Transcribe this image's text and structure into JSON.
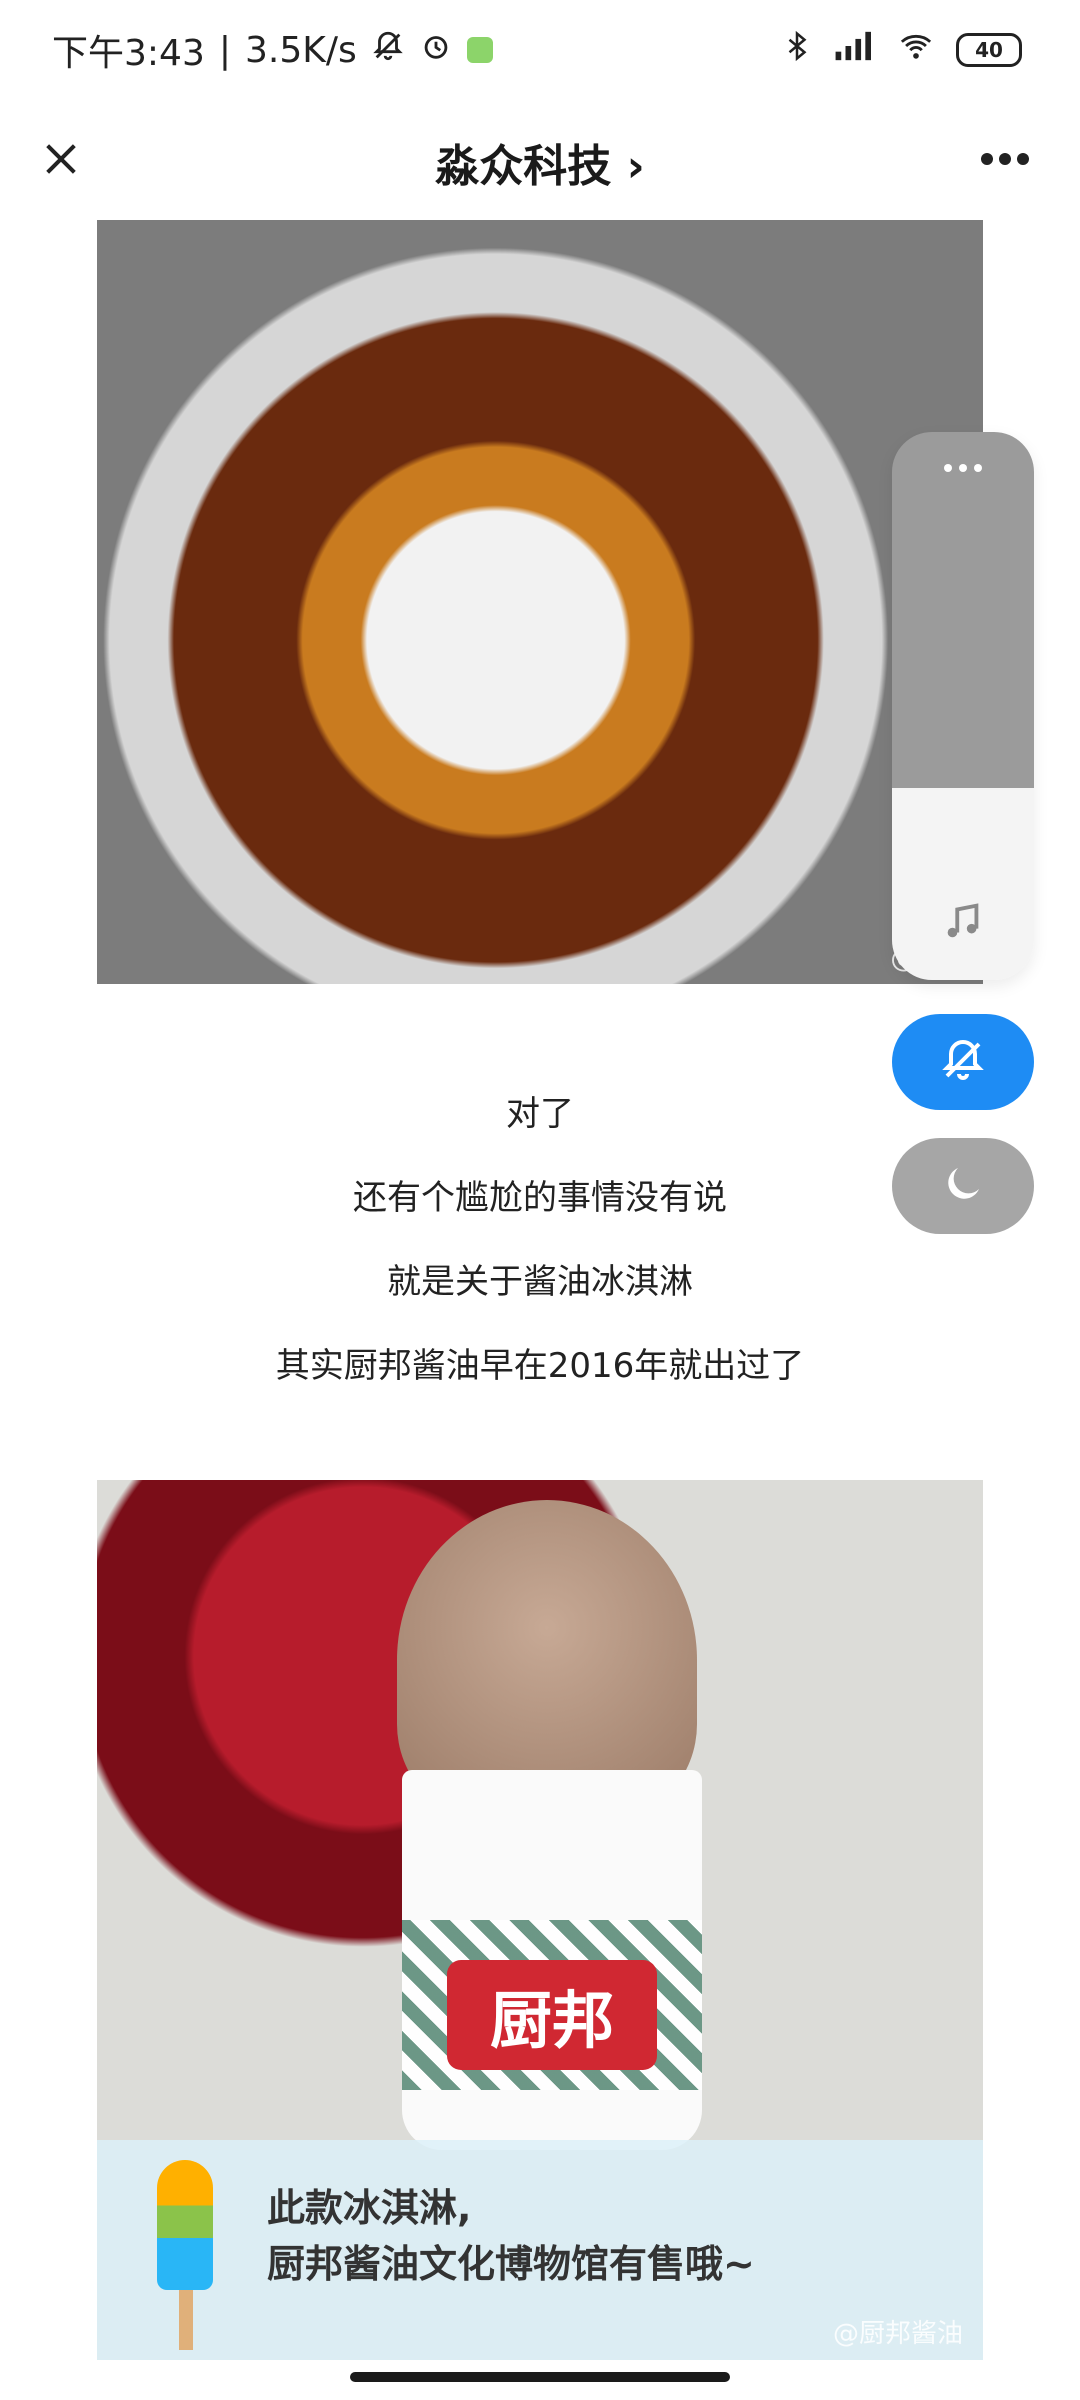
{
  "status_bar": {
    "time": "下午3:43",
    "separator": "|",
    "speed": "3.5K/s",
    "battery": "40",
    "icons": [
      "mute-bell-icon",
      "alarm-icon",
      "wechat-icon",
      "bluetooth-icon",
      "signal-icon",
      "wifi-icon",
      "battery-icon"
    ]
  },
  "nav": {
    "title": "淼众科技 ›",
    "left_icon": "close-icon",
    "right_icon": "more-icon"
  },
  "article": {
    "image1_watermark": "@feic",
    "lines": [
      "对了",
      "还有个尴尬的事情没有说",
      "就是关于酱油冰淇淋",
      "其实厨邦酱油早在2016年就出过了"
    ],
    "image2_brand": "厨邦",
    "image2_caption_1": "此款冰淇淋,",
    "image2_caption_2": "厨邦酱油文化博物馆有售哦~",
    "image2_watermark": "@厨邦酱油"
  },
  "float_panel": {
    "items": [
      "more-dots-icon",
      "music-icon"
    ],
    "mute_icon": "bell-mute-icon",
    "night_icon": "moon-icon",
    "accent_color": "#1e8cf4"
  }
}
